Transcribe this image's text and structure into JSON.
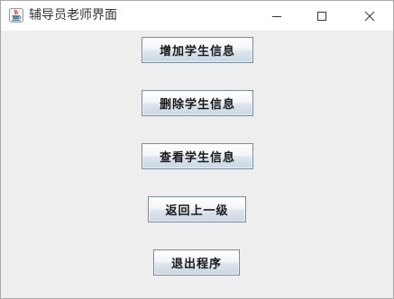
{
  "window": {
    "title": "辅导员老师界面",
    "icon": "java-cup-icon",
    "controls": {
      "minimize": "minimize-icon",
      "maximize": "maximize-icon",
      "close": "close-icon"
    }
  },
  "buttons": {
    "add_student": "增加学生信息",
    "delete_student": "删除学生信息",
    "view_student": "查看学生信息",
    "back": "返回上一级",
    "exit": "退出程序"
  },
  "colors": {
    "titlebar": "#ffffff",
    "content_bg": "#eeeeee",
    "button_border": "#7a8a99",
    "button_gradient_bottom": "#c9d6e2"
  }
}
